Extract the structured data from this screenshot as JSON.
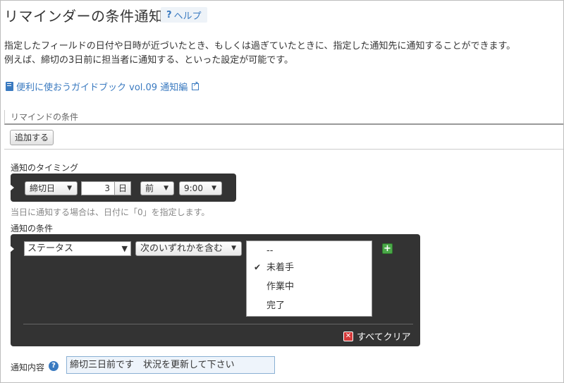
{
  "page": {
    "title": "リマインダーの条件通知",
    "help_label": "ヘルプ",
    "help_icon": "question-icon",
    "description_line1": "指定したフィールドの日付や日時が近づいたとき、もしくは過ぎていたときに、指定した通知先に通知することができます。",
    "description_line2": "例えば、締切の3日前に担当者に通知する、といった設定が可能です。",
    "guide_link": "便利に使おうガイドブック vol.09 通知編"
  },
  "section": {
    "header": "リマインドの条件",
    "add_button": "追加する"
  },
  "timing": {
    "label": "通知のタイミング",
    "field": "締切日",
    "days": "3",
    "unit": "日",
    "direction": "前",
    "time": "9:00",
    "hint": "当日に通知する場合は、日付に「0」を指定します。"
  },
  "condition": {
    "label": "通知の条件",
    "field": "ステータス",
    "operator": "次のいずれかを含む",
    "options": [
      {
        "label": "--",
        "checked": false
      },
      {
        "label": "未着手",
        "checked": true
      },
      {
        "label": "作業中",
        "checked": false
      },
      {
        "label": "完了",
        "checked": false
      }
    ],
    "check_mark": "✔",
    "clear_all": "すべてクリア"
  },
  "message": {
    "label": "通知内容",
    "value": "締切三日前です　状況を更新して下さい"
  },
  "colors": {
    "link": "#3a7ac0",
    "panel": "#333333",
    "plus": "#4aa848",
    "clear": "#d43a3a"
  }
}
